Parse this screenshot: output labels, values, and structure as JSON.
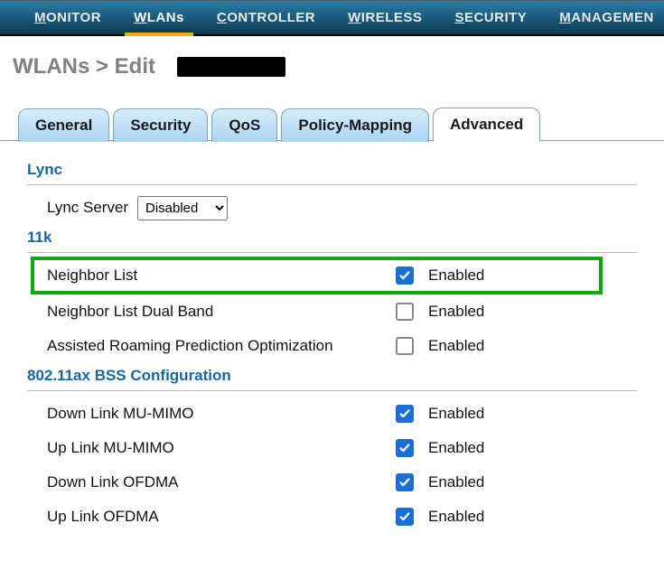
{
  "topnav": {
    "items": [
      {
        "label": "MONITOR",
        "u": "M"
      },
      {
        "label": "WLANs",
        "u": "W",
        "active": true
      },
      {
        "label": "CONTROLLER",
        "u": "C"
      },
      {
        "label": "WIRELESS",
        "u": "W"
      },
      {
        "label": "SECURITY",
        "u": "S"
      },
      {
        "label": "MANAGEMENT",
        "u": "M"
      }
    ]
  },
  "page": {
    "title": "WLANs > Edit"
  },
  "tabs": [
    {
      "label": "General"
    },
    {
      "label": "Security"
    },
    {
      "label": "QoS"
    },
    {
      "label": "Policy-Mapping"
    },
    {
      "label": "Advanced",
      "active": true
    }
  ],
  "sections": {
    "lync": {
      "title": "Lync",
      "server_label": "Lync Server",
      "server_value": "Disabled"
    },
    "elevenk": {
      "title": "11k",
      "rows": [
        {
          "label": "Neighbor List",
          "checked": true,
          "status": "Enabled",
          "highlight": true
        },
        {
          "label": "Neighbor List Dual Band",
          "checked": false,
          "status": "Enabled"
        },
        {
          "label": "Assisted Roaming Prediction Optimization",
          "checked": false,
          "status": "Enabled"
        }
      ]
    },
    "ax": {
      "title": "802.11ax BSS Configuration",
      "rows": [
        {
          "label": "Down Link MU-MIMO",
          "checked": true,
          "status": "Enabled"
        },
        {
          "label": "Up Link MU-MIMO",
          "checked": true,
          "status": "Enabled"
        },
        {
          "label": "Down Link OFDMA",
          "checked": true,
          "status": "Enabled"
        },
        {
          "label": "Up Link OFDMA",
          "checked": true,
          "status": "Enabled"
        }
      ]
    }
  }
}
